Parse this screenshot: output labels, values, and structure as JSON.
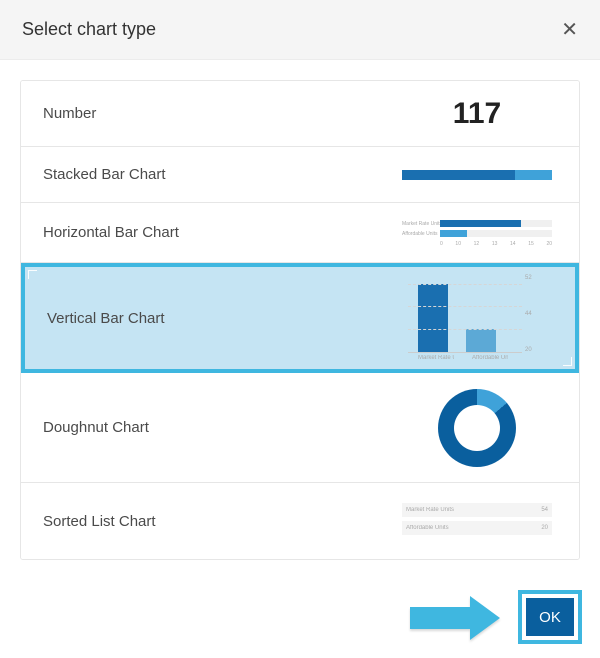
{
  "header": {
    "title": "Select chart type"
  },
  "options": {
    "number": {
      "label": "Number",
      "preview_value": "117"
    },
    "stacked": {
      "label": "Stacked Bar Chart"
    },
    "horizontal": {
      "label": "Horizontal Bar Chart"
    },
    "vertical": {
      "label": "Vertical Bar Chart",
      "selected": true
    },
    "doughnut": {
      "label": "Doughnut Chart"
    },
    "sorted": {
      "label": "Sorted List Chart"
    }
  },
  "previews": {
    "horizontal": {
      "series": [
        {
          "name": "Market Rate Units",
          "value": 72
        },
        {
          "name": "Affordable Units",
          "value": 24
        }
      ],
      "axis_ticks": [
        "0",
        "10",
        "12",
        "13",
        "14",
        "15",
        "20"
      ]
    },
    "vertical": {
      "series": [
        {
          "name": "Market Rate Units",
          "value": 52
        },
        {
          "name": "Affordable Units",
          "value": 20
        }
      ],
      "y_ticks": [
        "52",
        "44",
        "20"
      ]
    },
    "sorted": {
      "rows": [
        {
          "name": "Market Rate Units",
          "value": "54"
        },
        {
          "name": "Affordable Units",
          "value": "20"
        }
      ]
    }
  },
  "footer": {
    "ok_label": "OK"
  },
  "colors": {
    "primary": "#0a5f9e",
    "accent": "#3fa2d9",
    "highlight": "#3fb7e0",
    "selection_bg": "#c5e4f3"
  }
}
